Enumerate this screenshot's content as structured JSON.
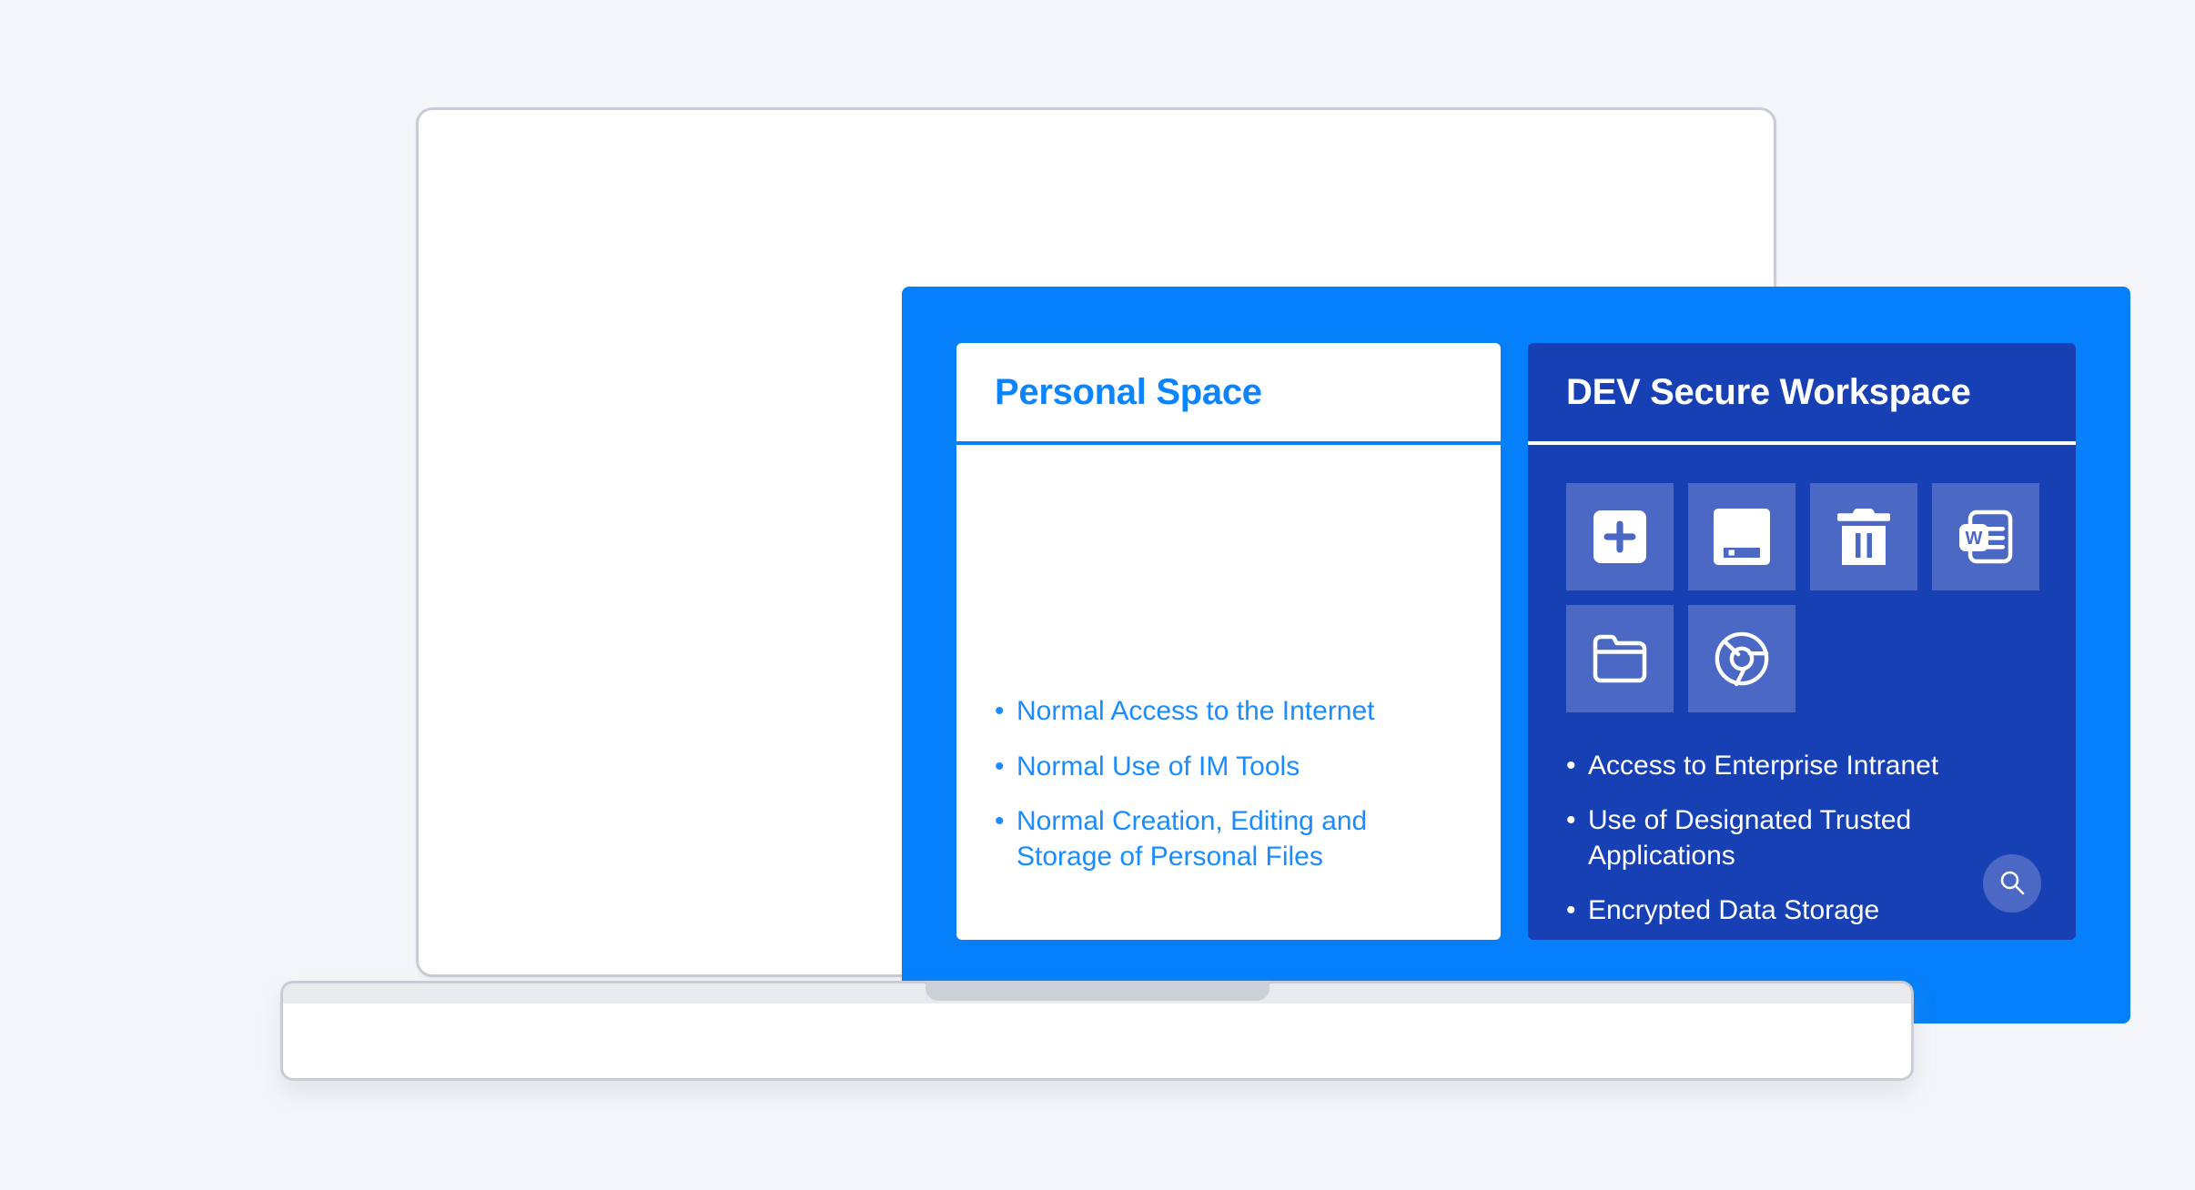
{
  "device": {
    "type": "laptop",
    "screen_label": "laptop-screen",
    "base_label": "laptop-base"
  },
  "app": {
    "background_color": "#0680fa",
    "panels": {
      "personal": {
        "title": "Personal Space",
        "title_color": "#0a84ff",
        "background_color": "#ffffff",
        "divider_color": "#0680fa",
        "bullets": [
          "Normal Access to the Internet",
          "Normal Use of IM Tools",
          "Normal Creation, Editing and Storage of Personal Files"
        ],
        "bullet_marker": "•",
        "bullet_text_color": "#1a8cff"
      },
      "secure": {
        "title": "DEV Secure Workspace",
        "title_color": "#ffffff",
        "background_color": "#1840b5",
        "divider_color": "#ffffff",
        "tile_color": "#4a68c4",
        "apps": [
          {
            "name": "add-new",
            "icon": "plus-square-icon"
          },
          {
            "name": "save-disk",
            "icon": "floppy-disk-icon"
          },
          {
            "name": "delete",
            "icon": "trash-icon"
          },
          {
            "name": "word-document",
            "icon": "word-document-icon",
            "glyph": "W"
          },
          {
            "name": "file-manager",
            "icon": "folder-icon"
          },
          {
            "name": "chrome-browser",
            "icon": "chrome-icon"
          }
        ],
        "bullets": [
          "Access to Enterprise Intranet",
          "Use of Designated Trusted Applications",
          "Encrypted Data Storage"
        ],
        "bullet_marker": "•",
        "bullet_text_color": "#ffffff",
        "search_button": {
          "icon": "search-icon",
          "background_color": "#4a68c4"
        }
      }
    }
  }
}
